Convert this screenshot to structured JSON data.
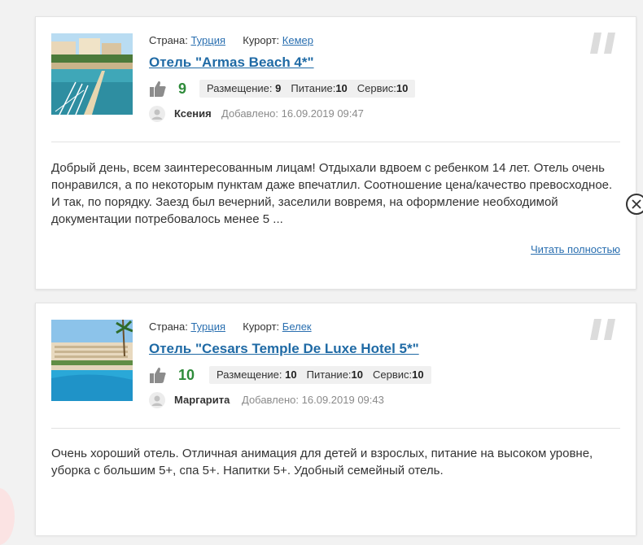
{
  "labels": {
    "country": "Страна:",
    "resort": "Курорт:",
    "placement": "Размещение:",
    "food": "Питание:",
    "service": "Сервис:",
    "added": "Добавлено:",
    "read_more": "Читать полностью"
  },
  "reviews": [
    {
      "country": "Турция",
      "resort": "Кемер",
      "hotel": "Отель \"Armas Beach 4*\"",
      "score": "9",
      "placement": "9",
      "food": "10",
      "service": "10",
      "author": "Ксения",
      "date": "16.09.2019 09:47",
      "text": "Добрый день, всем заинтересованным лицам! Отдыхали вдвоем с ребенком 14 лет. Отель очень понравился, а по некоторым пунктам даже впечатлил. Соотношение цена/качество превосходное. И так, по порядку. Заезд был вечерний, заселили вовремя, на оформление необходимой документации потребовалось менее 5 ..."
    },
    {
      "country": "Турция",
      "resort": "Белек",
      "hotel": "Отель \"Cesars Temple De Luxe Hotel 5*\"",
      "score": "10",
      "placement": "10",
      "food": "10",
      "service": "10",
      "author": "Маргарита",
      "date": "16.09.2019 09:43",
      "text": "Очень хороший отель. Отличная анимация для детей и взрослых, питание на высоком уровне, уборка с большим 5+, спа 5+. Напитки 5+. Удобный семейный отель."
    }
  ],
  "icons": {
    "like": "thumbs-up-icon",
    "avatar": "user-avatar-icon",
    "quote": "quote-icon",
    "close": "close-icon"
  },
  "colors": {
    "link": "#2a6fb0",
    "title": "#1f6aa5",
    "score": "#2e8b3a"
  }
}
